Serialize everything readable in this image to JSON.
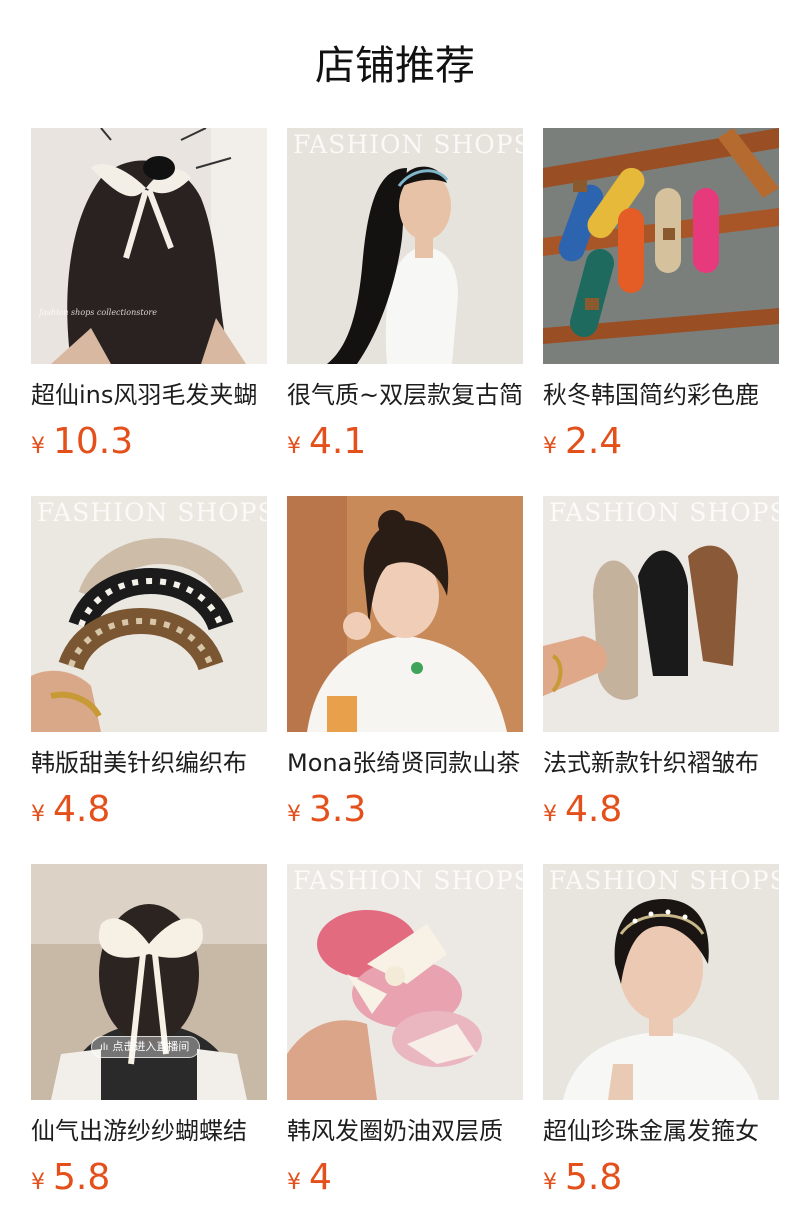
{
  "page": {
    "title": "店铺推荐"
  },
  "colors": {
    "price": "#e4501b",
    "text": "#1e1e1e",
    "background": "#ffffff"
  },
  "products": [
    {
      "name": "超仙ins风羽毛发夹蝴",
      "currency": "¥",
      "price": "10.3",
      "image": "hair-clip-bow-back-view",
      "overlay_text": "fashion shops collectionstore"
    },
    {
      "name": "很气质~双层款复古简",
      "currency": "¥",
      "price": "4.1",
      "image": "thin-headband-profile",
      "watermark": "FASHION  SHOPS"
    },
    {
      "name": "秋冬韩国简约彩色鹿",
      "currency": "¥",
      "price": "2.4",
      "image": "colorful-hair-clips"
    },
    {
      "name": "韩版甜美针织编织布",
      "currency": "¥",
      "price": "4.8",
      "image": "knit-striped-headbands",
      "watermark": "FASHION  SHOPS"
    },
    {
      "name": "Mona张绮贤同款山茶",
      "currency": "¥",
      "price": "3.3",
      "image": "model-white-tshirt"
    },
    {
      "name": "法式新款针织褶皱布",
      "currency": "¥",
      "price": "4.8",
      "image": "pleated-headbands",
      "watermark": "FASHION  SHOPS"
    },
    {
      "name": "仙气出游纱纱蝴蝶结",
      "currency": "¥",
      "price": "5.8",
      "image": "big-ribbon-bow",
      "live_badge": "点击进入直播间"
    },
    {
      "name": "韩风发圈奶油双层质",
      "currency": "¥",
      "price": "4",
      "image": "satin-bow-scrunchies",
      "watermark": "FASHION  SHOPS"
    },
    {
      "name": "超仙珍珠金属发箍女",
      "currency": "¥",
      "price": "5.8",
      "image": "pearl-metal-headband",
      "watermark": "FASHION  SHOPS"
    }
  ]
}
